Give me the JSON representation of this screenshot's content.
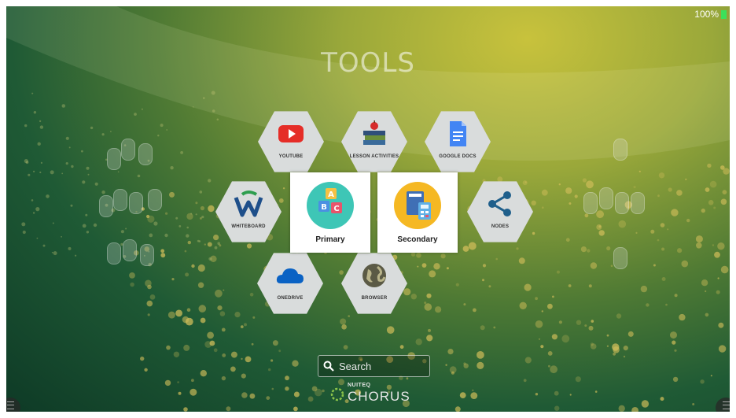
{
  "status": {
    "battery_text": "100%"
  },
  "header": {
    "title": "TOOLS"
  },
  "tools": {
    "youtube": "YOUTUBE",
    "lesson_activities": "LESSON ACTIVITIES",
    "google_docs": "GOOGLE DOCS",
    "whiteboard": "WHITEBOARD",
    "nodes": "NODES",
    "onedrive": "ONEDRIVE",
    "browser": "BROWSER"
  },
  "cards": {
    "primary": "Primary",
    "secondary": "Secondary"
  },
  "search": {
    "placeholder": "Search"
  },
  "brand": {
    "small": "NUITEQ",
    "big": "CHORUS"
  },
  "colors": {
    "battery": "#3ce05a",
    "youtube": "#e52d27",
    "docs": "#4285f4",
    "onedrive": "#0a62c4"
  }
}
